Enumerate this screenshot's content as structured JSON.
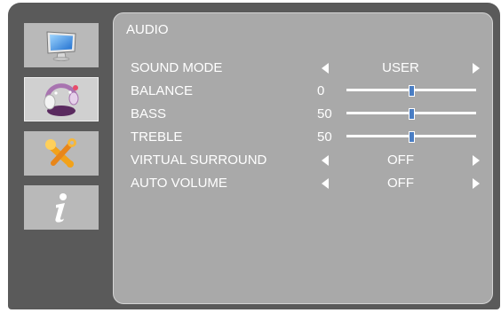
{
  "sidebar": {
    "items": [
      {
        "icon": "monitor-icon"
      },
      {
        "icon": "audio-icon",
        "active": true
      },
      {
        "icon": "tools-icon"
      },
      {
        "icon": "info-icon"
      }
    ]
  },
  "panel": {
    "title": "AUDIO",
    "rows": [
      {
        "label": "SOUND MODE",
        "value": "USER"
      },
      {
        "label": "BALANCE",
        "number": "0",
        "level": 0.5
      },
      {
        "label": "BASS",
        "number": "50",
        "level": 0.5
      },
      {
        "label": "TREBLE",
        "number": "50",
        "level": 0.5
      },
      {
        "label": "VIRTUAL SURROUND",
        "value": "OFF"
      },
      {
        "label": "AUTO VOLUME",
        "value": "OFF"
      }
    ]
  },
  "colors": {
    "frame": "#5a5a5a",
    "panel": "#a9a9a9",
    "sidebar_button": "#b9b9b9",
    "slider_knob": "#4a7ec4"
  }
}
